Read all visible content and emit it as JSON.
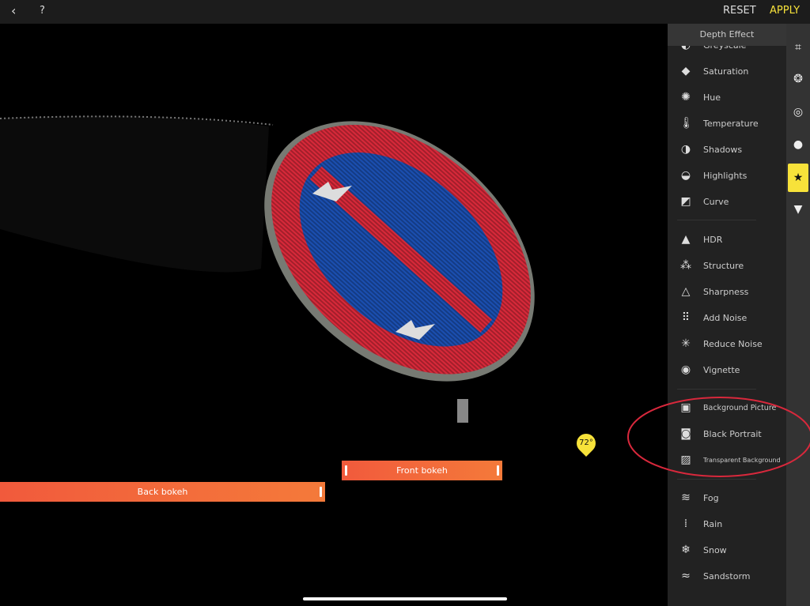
{
  "topbar": {
    "back_icon": "chevron-left-icon",
    "help_label": "?",
    "reset_label": "RESET",
    "apply_label": "APPLY",
    "accent": "#f7e23a"
  },
  "panel": {
    "title": "Depth Effect",
    "groups": [
      [
        {
          "label": "Greyscale",
          "icon": "circle-half-icon"
        },
        {
          "label": "Saturation",
          "icon": "paint-bucket-icon"
        },
        {
          "label": "Hue",
          "icon": "hue-ring-icon"
        },
        {
          "label": "Temperature",
          "icon": "thermometer-icon"
        },
        {
          "label": "Shadows",
          "icon": "shadows-icon"
        },
        {
          "label": "Highlights",
          "icon": "highlights-icon"
        },
        {
          "label": "Curve",
          "icon": "curve-icon"
        }
      ],
      [
        {
          "label": "HDR",
          "icon": "mountain-icon"
        },
        {
          "label": "Structure",
          "icon": "structure-icon"
        },
        {
          "label": "Sharpness",
          "icon": "triangle-icon"
        },
        {
          "label": "Add Noise",
          "icon": "noise-icon"
        },
        {
          "label": "Reduce Noise",
          "icon": "sparkle-icon"
        },
        {
          "label": "Vignette",
          "icon": "vignette-icon"
        }
      ],
      [
        {
          "label": "Background Picture",
          "icon": "picture-icon"
        },
        {
          "label": "Black Portrait",
          "icon": "portrait-icon"
        },
        {
          "label": "Transparent Background",
          "icon": "transparent-picture-icon"
        }
      ],
      [
        {
          "label": "Fog",
          "icon": "fog-icon"
        },
        {
          "label": "Rain",
          "icon": "rain-icon"
        },
        {
          "label": "Snow",
          "icon": "snowflake-icon"
        },
        {
          "label": "Sandstorm",
          "icon": "wind-icon"
        }
      ]
    ]
  },
  "rail": [
    "crop-icon",
    "aperture-icon",
    "lens-icon",
    "lightbulb-icon",
    "magic-wand-icon",
    "brush-icon"
  ],
  "canvas": {
    "front_bokeh": "Front bokeh",
    "back_bokeh": "Back bokeh",
    "angle": "72°"
  }
}
